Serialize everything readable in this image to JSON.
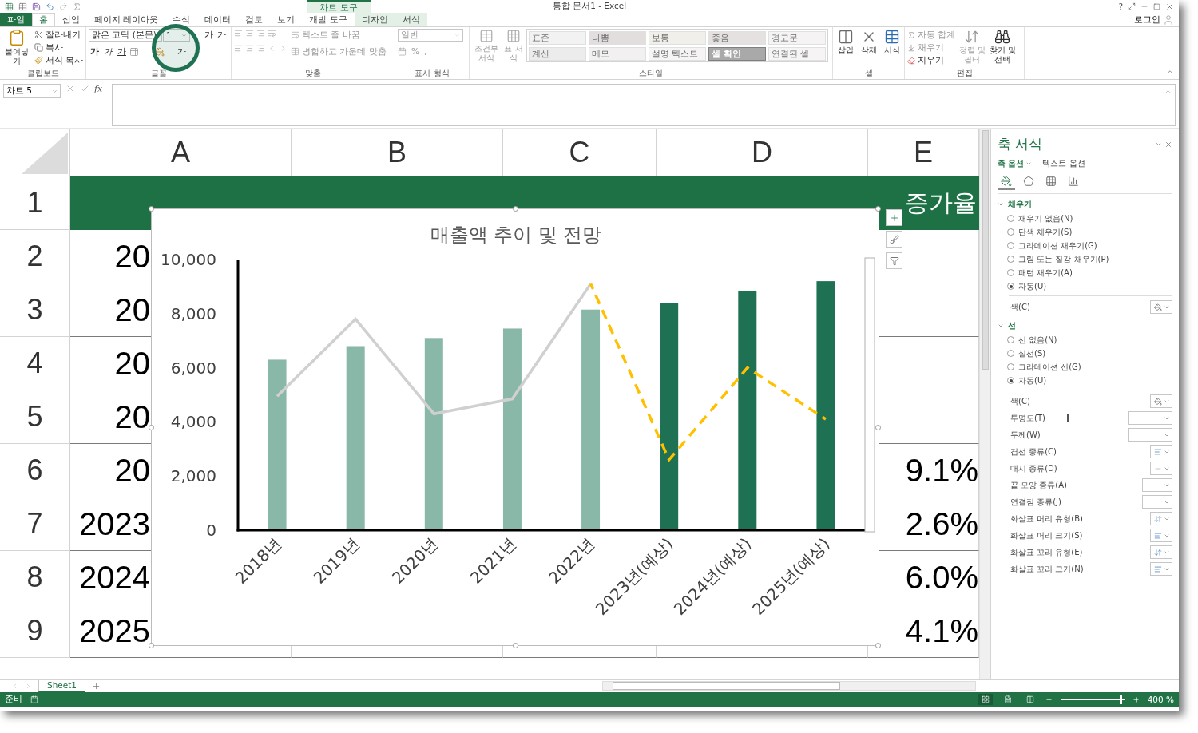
{
  "window": {
    "title": "통합 문서1 - Excel",
    "help": "?",
    "account": "로그인"
  },
  "context_group": "차트 도구",
  "tabs": [
    {
      "label": "파일",
      "kind": "file",
      "selected": false
    },
    {
      "label": "홈",
      "kind": "normal",
      "selected": true
    },
    {
      "label": "삽입",
      "kind": "normal",
      "selected": false
    },
    {
      "label": "페이지 레이아웃",
      "kind": "normal",
      "selected": false
    },
    {
      "label": "수식",
      "kind": "normal",
      "selected": false
    },
    {
      "label": "데이터",
      "kind": "normal",
      "selected": false
    },
    {
      "label": "검토",
      "kind": "normal",
      "selected": false
    },
    {
      "label": "보기",
      "kind": "normal",
      "selected": false
    },
    {
      "label": "개발 도구",
      "kind": "normal",
      "selected": false
    },
    {
      "label": "디자인",
      "kind": "context",
      "selected": false
    },
    {
      "label": "서식",
      "kind": "context",
      "selected": false
    }
  ],
  "ribbon": {
    "clipboard": {
      "label": "클립보드",
      "paste": "붙여넣기",
      "items": [
        {
          "label": "잘라내기",
          "kind": "cut",
          "disabled": false
        },
        {
          "label": "복사",
          "kind": "copy",
          "disabled": false
        },
        {
          "label": "서식 복사",
          "kind": "painter",
          "disabled": false
        }
      ]
    },
    "font": {
      "label": "글꼴",
      "font_name": "맑은 고딕 (본문)",
      "font_size": "1",
      "size_buttons": [
        "가",
        "가"
      ],
      "style_buttons": [
        "가",
        "가",
        "가"
      ],
      "font_color": "가"
    },
    "alignment": {
      "label": "맞춤",
      "wrap": "텍스트 줄 바꿈",
      "merge": "병합하고 가운데 맞춤",
      "disabled": true
    },
    "number": {
      "label": "표시 형식",
      "format": "일반",
      "percent": "%",
      "comma": ",",
      "disabled": true
    },
    "styles": {
      "label": "스타일",
      "conditional": "조건부 서식",
      "table": "표 서식",
      "disabled": true,
      "cells": [
        {
          "label": "표준",
          "color": "#f2f2f2"
        },
        {
          "label": "나쁨",
          "color": "#e3dede"
        },
        {
          "label": "보통",
          "color": "#f1efe9"
        },
        {
          "label": "좋음",
          "color": "#e5e1e1"
        },
        {
          "label": "경고문",
          "color": "#f5f3f3"
        },
        {
          "label": "계산",
          "color": "#ececec"
        },
        {
          "label": "메모",
          "color": "#f2f0f0"
        },
        {
          "label": "설명 텍스트",
          "color": "#f6f4f4"
        },
        {
          "label": "셀 확인",
          "color": "#a9a9a9"
        },
        {
          "label": "연결된 셀",
          "color": "#f6f4f4"
        }
      ]
    },
    "cells": {
      "label": "셀",
      "items": [
        {
          "label": "삽입",
          "kind": "insert",
          "disabled": false
        },
        {
          "label": "삭제",
          "kind": "delete",
          "disabled": false
        },
        {
          "label": "서식",
          "kind": "format",
          "disabled": false
        }
      ]
    },
    "editing": {
      "label": "편집",
      "items": [
        {
          "label": "자동 합계",
          "kind": "sum",
          "disabled": true
        },
        {
          "label": "채우기",
          "kind": "fill",
          "disabled": true
        },
        {
          "label": "지우기",
          "kind": "clear",
          "disabled": false
        },
        {
          "label": "정렬 및 필터",
          "kind": "sort",
          "disabled": true
        },
        {
          "label": "찾기 및 선택",
          "kind": "find",
          "disabled": false
        }
      ]
    }
  },
  "formula_bar": {
    "name_box": "차트 5",
    "function_button": "fx"
  },
  "sheet": {
    "columns": [
      "A",
      "B",
      "C",
      "D",
      "E"
    ],
    "rows": [
      {
        "number": "1",
        "header": true,
        "e": "증가율"
      },
      {
        "number": "2",
        "header": false,
        "a": "20"
      },
      {
        "number": "3",
        "header": false,
        "a": "20"
      },
      {
        "number": "4",
        "header": false,
        "a": "20"
      },
      {
        "number": "5",
        "header": false,
        "a": "20"
      },
      {
        "number": "6",
        "header": false,
        "a": "20",
        "e": "9.1%"
      },
      {
        "number": "7",
        "header": false,
        "a": "2023",
        "e": "2.6%"
      },
      {
        "number": "8",
        "header": false,
        "a": "2024",
        "e": "6.0%"
      },
      {
        "number": "9",
        "header": false,
        "a": "2025",
        "e": "4.1%"
      }
    ]
  },
  "chart": {
    "selected": true,
    "chart_data": {
      "type": "bar",
      "title": "매출액 추이 및 전망",
      "categories": [
        "2018년",
        "2019년",
        "2020년",
        "2021년",
        "2022년",
        "2023년(예상)",
        "2024년(예상)",
        "2025년(예상)"
      ],
      "ylim": [
        0,
        10000
      ],
      "yticks": [
        {
          "value": 0,
          "label": "0"
        },
        {
          "value": 2000,
          "label": "2,000"
        },
        {
          "value": 4000,
          "label": "4,000"
        },
        {
          "value": 6000,
          "label": "6,000"
        },
        {
          "value": 8000,
          "label": "8,000"
        },
        {
          "value": 10000,
          "label": "10,000"
        }
      ],
      "series": [
        {
          "color": "#8ab8a8",
          "values": [
            6300,
            6800,
            7100,
            7450,
            8150,
            null,
            null,
            null
          ]
        },
        {
          "color": "#1e7152",
          "values": [
            null,
            null,
            null,
            null,
            null,
            8400,
            8850,
            9200
          ]
        },
        {
          "type": "line",
          "line_style": "solid",
          "color": "#d0d0d0",
          "values": [
            4950,
            7800,
            4300,
            4850,
            9100,
            null,
            null,
            null
          ]
        },
        {
          "type": "line",
          "line_style": "dashed",
          "color": "#ffc000",
          "values": [
            null,
            null,
            null,
            null,
            9100,
            2600,
            6000,
            4100
          ]
        }
      ]
    }
  },
  "pane": {
    "title": "축 서식",
    "tabs": [
      {
        "label": "축 옵션",
        "selected": true
      },
      {
        "label": "텍스트 옵션",
        "selected": false
      }
    ],
    "icon_tabs": [
      {
        "kind": "fill",
        "selected": true
      },
      {
        "kind": "effects",
        "selected": false
      },
      {
        "kind": "size",
        "selected": false
      },
      {
        "kind": "axis",
        "selected": false
      }
    ],
    "sections": [
      {
        "title": "채우기",
        "expanded": true,
        "options": [
          {
            "label": "채우기 없음(N)",
            "selected": false
          },
          {
            "label": "단색 채우기(S)",
            "selected": false
          },
          {
            "label": "그라데이션 채우기(G)",
            "selected": false
          },
          {
            "label": "그림 또는 질감 채우기(P)",
            "selected": false
          },
          {
            "label": "패턴 채우기(A)",
            "selected": false
          },
          {
            "label": "자동(U)",
            "selected": true
          }
        ],
        "properties": [
          {
            "label": "색(C)",
            "kind": "color"
          }
        ]
      },
      {
        "title": "선",
        "expanded": true,
        "options": [
          {
            "label": "선 없음(N)",
            "selected": false
          },
          {
            "label": "실선(S)",
            "selected": false
          },
          {
            "label": "그라데이션 선(G)",
            "selected": false
          },
          {
            "label": "자동(U)",
            "selected": true
          }
        ],
        "properties": [
          {
            "label": "색(C)",
            "kind": "color"
          },
          {
            "label": "투명도(T)",
            "kind": "slider",
            "level": 0
          },
          {
            "label": "두께(W)",
            "kind": "spin"
          },
          {
            "label": "겹선 종류(C)",
            "kind": "lines"
          },
          {
            "label": "대시 종류(D)",
            "kind": "dash"
          },
          {
            "label": "끝 모양 종류(A)",
            "kind": "dropdown"
          },
          {
            "label": "연결점 종류(J)",
            "kind": "dropdown"
          },
          {
            "label": "화살표 머리 유형(B)",
            "kind": "arrow"
          },
          {
            "label": "화살표 머리 크기(S)",
            "kind": "lines"
          },
          {
            "label": "화살표 꼬리 유형(E)",
            "kind": "arrow"
          },
          {
            "label": "화살표 꼬리 크기(N)",
            "kind": "lines"
          }
        ]
      }
    ]
  },
  "sheet_tabs": [
    {
      "label": "Sheet1",
      "selected": true
    }
  ],
  "status_bar": {
    "text": "준비",
    "views": [
      {
        "kind": "normal",
        "selected": true
      },
      {
        "kind": "layout",
        "selected": false
      },
      {
        "kind": "break",
        "selected": false
      }
    ],
    "zoom": "400 %",
    "zoom_slider": {
      "level": 0.96
    }
  }
}
